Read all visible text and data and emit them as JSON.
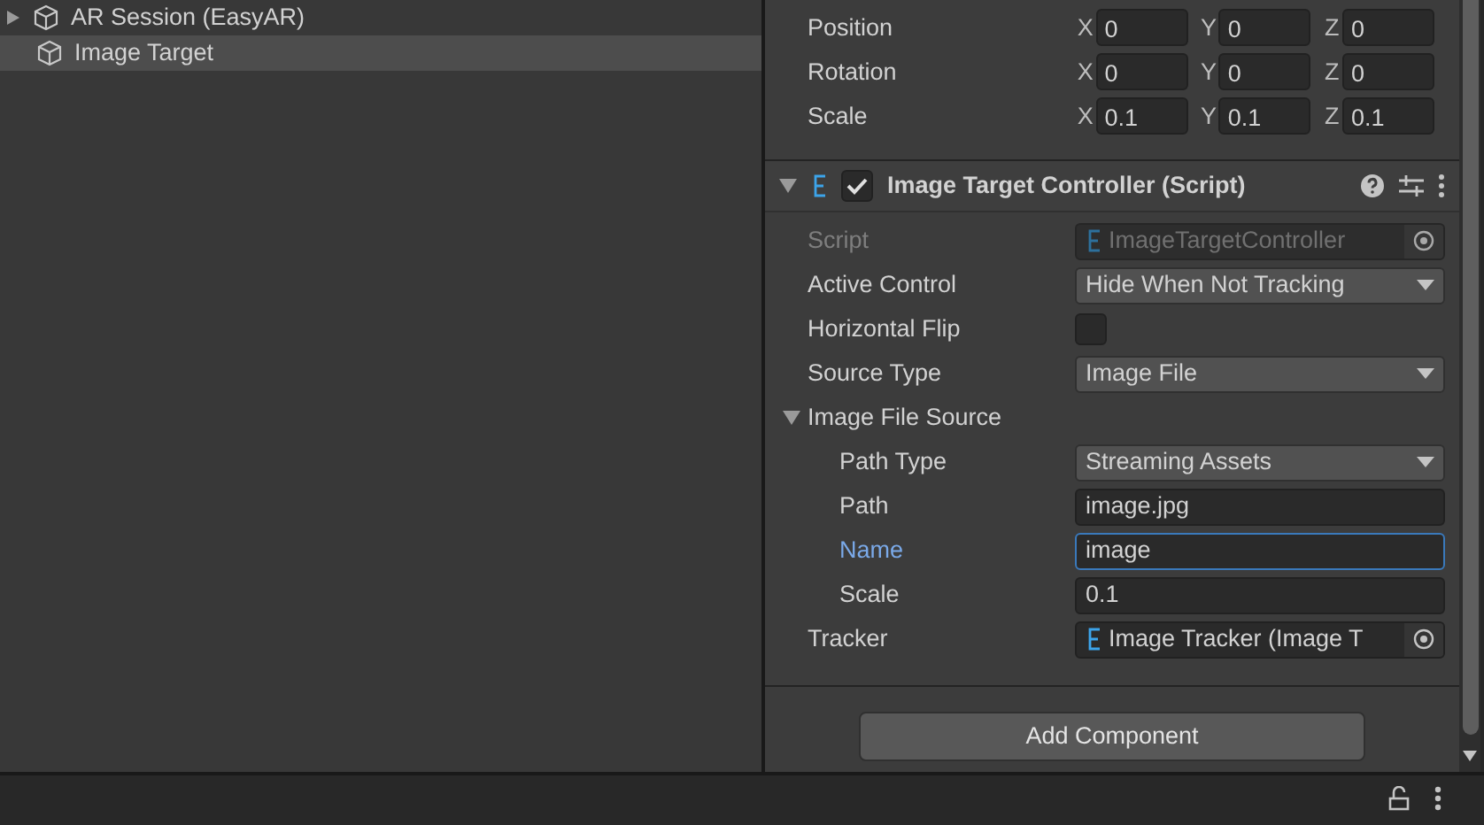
{
  "hierarchy": {
    "items": [
      {
        "label": "AR Session (EasyAR)",
        "selected": false
      },
      {
        "label": "Image Target",
        "selected": true
      }
    ]
  },
  "transform": [
    {
      "label": "Position",
      "axes": [
        {
          "axis": "X",
          "value": "0"
        },
        {
          "axis": "Y",
          "value": "0"
        },
        {
          "axis": "Z",
          "value": "0"
        }
      ]
    },
    {
      "label": "Rotation",
      "axes": [
        {
          "axis": "X",
          "value": "0"
        },
        {
          "axis": "Y",
          "value": "0"
        },
        {
          "axis": "Z",
          "value": "0"
        }
      ]
    },
    {
      "label": "Scale",
      "axes": [
        {
          "axis": "X",
          "value": "0.1"
        },
        {
          "axis": "Y",
          "value": "0.1"
        },
        {
          "axis": "Z",
          "value": "0.1"
        }
      ]
    }
  ],
  "component": {
    "title": "Image Target Controller (Script)",
    "enabled": true,
    "expanded": true,
    "fields": [
      {
        "kind": "object",
        "label": "Script",
        "value": "ImageTargetController",
        "disabled": true,
        "focused": false
      },
      {
        "kind": "dropdown",
        "label": "Active Control",
        "value": "Hide When Not Tracking",
        "disabled": false,
        "focused": false
      },
      {
        "kind": "checkbox",
        "label": "Horizontal Flip",
        "checked": false,
        "disabled": false,
        "focused": false
      },
      {
        "kind": "dropdown",
        "label": "Source Type",
        "value": "Image File",
        "disabled": false,
        "focused": false
      },
      {
        "kind": "foldout",
        "label": "Image File Source",
        "expanded": true,
        "disabled": false,
        "focused": false,
        "children": [
          {
            "kind": "dropdown",
            "label": "Path Type",
            "value": "Streaming Assets",
            "disabled": false,
            "focused": false
          },
          {
            "kind": "text",
            "label": "Path",
            "value": "image.jpg",
            "disabled": false,
            "focused": false
          },
          {
            "kind": "text",
            "label": "Name",
            "value": "image",
            "disabled": false,
            "focused": true
          },
          {
            "kind": "text",
            "label": "Scale",
            "value": "0.1",
            "disabled": false,
            "focused": false
          }
        ]
      },
      {
        "kind": "object",
        "label": "Tracker",
        "value": "Image Tracker (Image T",
        "disabled": false,
        "focused": false
      }
    ]
  },
  "add_component_button": "Add Component"
}
